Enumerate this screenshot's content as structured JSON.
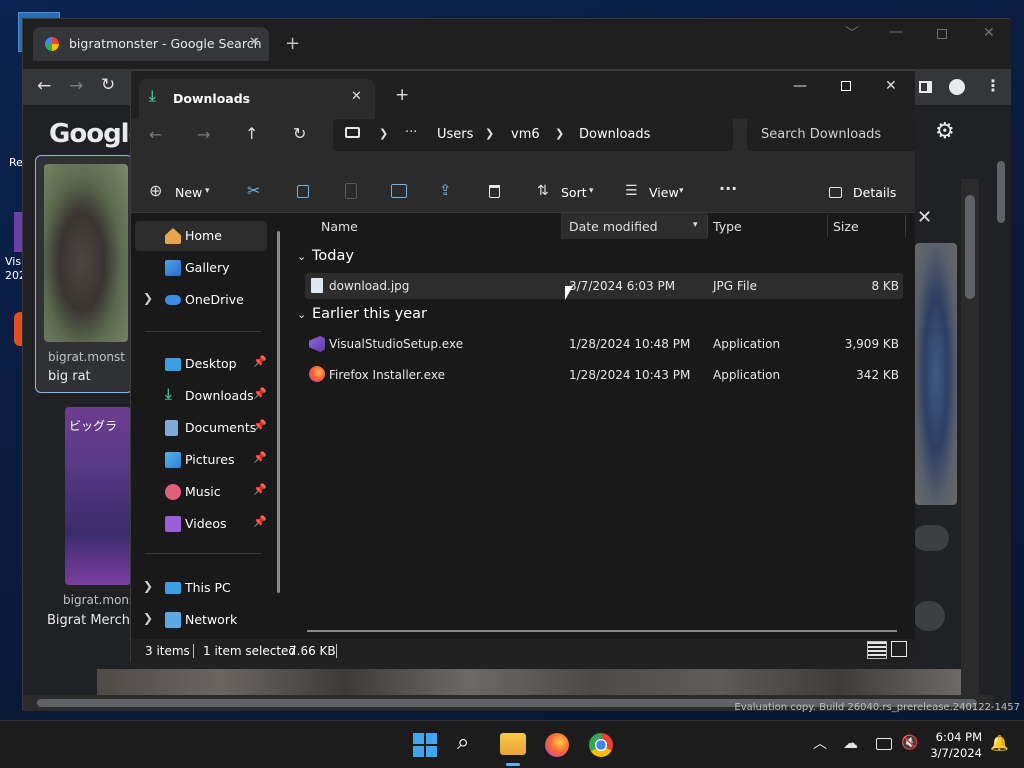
{
  "desktop": {
    "icons": [
      {
        "label": "Re"
      },
      {
        "label": "Visu"
      },
      {
        "label": "202"
      }
    ],
    "watermark": "Evaluation copy. Build 26040.rs_prerelease.240122-1457"
  },
  "browser": {
    "tab_title": "bigratmonster - Google Search",
    "google_logo": "Google",
    "results": [
      {
        "source": "bigrat.monst",
        "title": "big rat"
      },
      {
        "source": "bigrat.monst",
        "title": "Bigrat Merch"
      }
    ],
    "merch_text": "ビッグラ"
  },
  "explorer": {
    "tab_title": "Downloads",
    "breadcrumb": [
      "Users",
      "vm6",
      "Downloads"
    ],
    "search_placeholder": "Search Downloads",
    "commands": {
      "new": "New",
      "sort": "Sort",
      "view": "View",
      "details": "Details"
    },
    "nav": {
      "home": "Home",
      "gallery": "Gallery",
      "onedrive": "OneDrive",
      "desktop": "Desktop",
      "downloads": "Downloads",
      "documents": "Documents",
      "pictures": "Pictures",
      "music": "Music",
      "videos": "Videos",
      "thispc": "This PC",
      "network": "Network"
    },
    "columns": {
      "name": "Name",
      "date": "Date modified",
      "type": "Type",
      "size": "Size"
    },
    "groups": [
      {
        "label": "Today",
        "files": [
          {
            "name": "download.jpg",
            "date": "3/7/2024 6:03 PM",
            "type": "JPG File",
            "size": "8 KB"
          }
        ]
      },
      {
        "label": "Earlier this year",
        "files": [
          {
            "name": "VisualStudioSetup.exe",
            "date": "1/28/2024 10:48 PM",
            "type": "Application",
            "size": "3,909 KB"
          },
          {
            "name": "Firefox Installer.exe",
            "date": "1/28/2024 10:43 PM",
            "type": "Application",
            "size": "342 KB"
          }
        ]
      }
    ],
    "status": {
      "count": "3 items",
      "selected": "1 item selected",
      "size": "7.66 KB"
    }
  },
  "taskbar": {
    "time": "6:04 PM",
    "date": "3/7/2024"
  }
}
